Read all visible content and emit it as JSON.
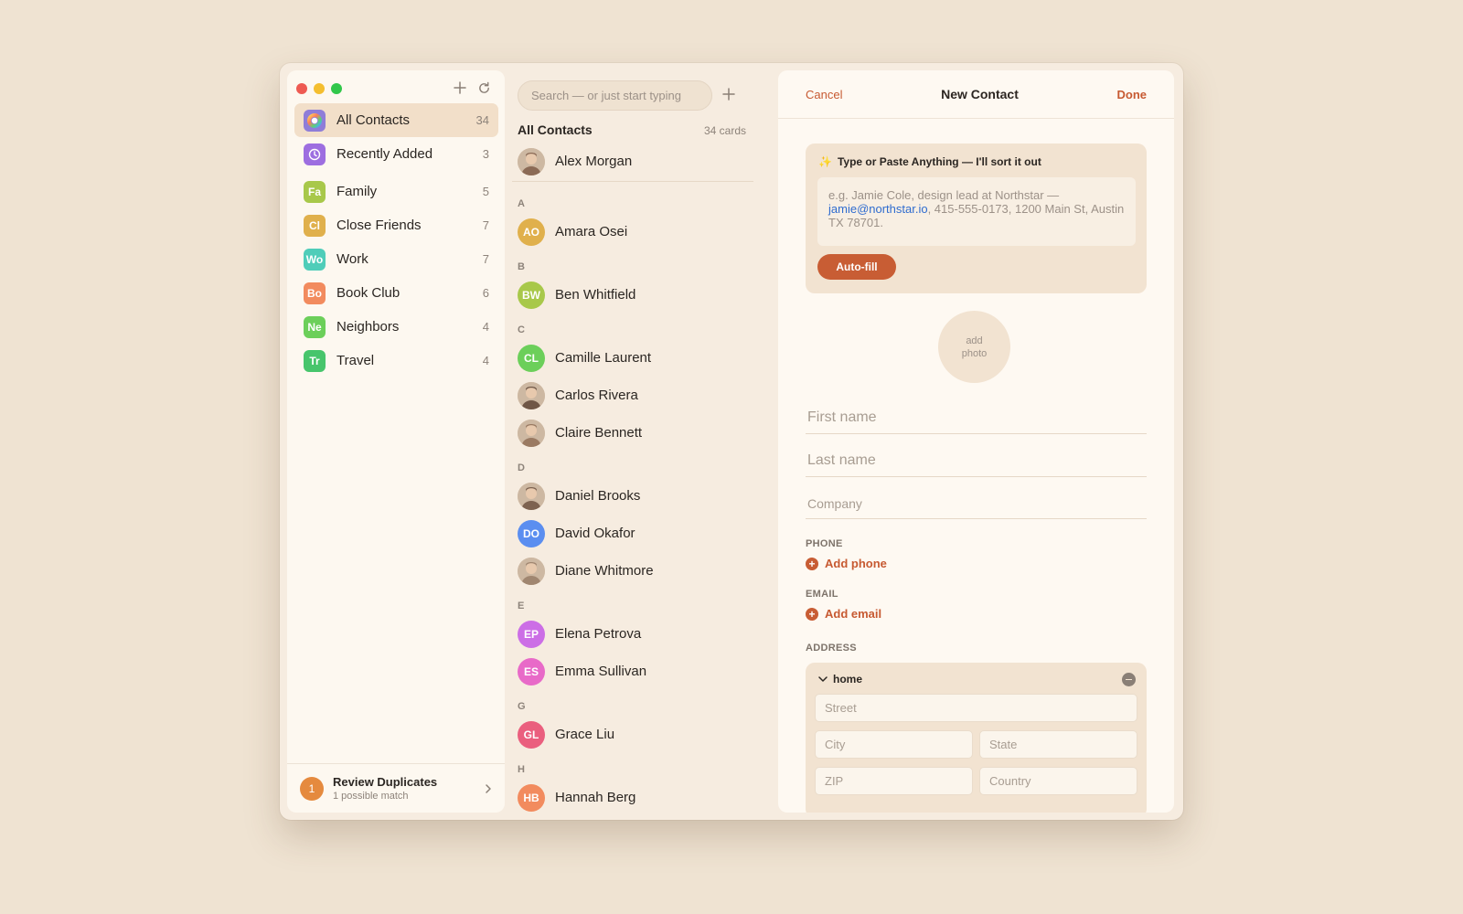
{
  "sidebar": {
    "items": [
      {
        "label": "All Contacts",
        "count": "34",
        "icon": "rainbow-ring-icon",
        "active": true
      },
      {
        "label": "Recently Added",
        "count": "3",
        "icon": "clock-icon",
        "color": "#9d6ee0"
      },
      {
        "label": "Family",
        "count": "5",
        "abbr": "Fa",
        "color": "#a8c84a"
      },
      {
        "label": "Close Friends",
        "count": "7",
        "abbr": "Cl",
        "color": "#e0b04c"
      },
      {
        "label": "Work",
        "count": "7",
        "abbr": "Wo",
        "color": "#4fcdb9"
      },
      {
        "label": "Book Club",
        "count": "6",
        "abbr": "Bo",
        "color": "#f28b5e"
      },
      {
        "label": "Neighbors",
        "count": "4",
        "abbr": "Ne",
        "color": "#6ccf5a"
      },
      {
        "label": "Travel",
        "count": "4",
        "abbr": "Tr",
        "color": "#47c56c"
      }
    ],
    "duplicates": {
      "count": "1",
      "title": "Review Duplicates",
      "subtitle": "1 possible match"
    }
  },
  "list": {
    "search_placeholder": "Search — or just start typing",
    "heading": "All Contacts",
    "card_count": "34 cards",
    "me": {
      "name": "Alex Morgan",
      "photo": true
    },
    "sections": [
      {
        "letter": "A",
        "contacts": [
          {
            "name": "Amara Osei",
            "initials": "AO",
            "color": "#e0b04c"
          }
        ]
      },
      {
        "letter": "B",
        "contacts": [
          {
            "name": "Ben Whitfield",
            "initials": "BW",
            "color": "#a8c84a"
          }
        ]
      },
      {
        "letter": "C",
        "contacts": [
          {
            "name": "Camille Laurent",
            "initials": "CL",
            "color": "#6ccf5a"
          },
          {
            "name": "Carlos Rivera",
            "photo": true
          },
          {
            "name": "Claire Bennett",
            "photo": true
          }
        ]
      },
      {
        "letter": "D",
        "contacts": [
          {
            "name": "Daniel Brooks",
            "photo": true
          },
          {
            "name": "David Okafor",
            "initials": "DO",
            "color": "#5b8ef0"
          },
          {
            "name": "Diane Whitmore",
            "photo": true
          }
        ]
      },
      {
        "letter": "E",
        "contacts": [
          {
            "name": "Elena Petrova",
            "initials": "EP",
            "color": "#cc6ee6"
          },
          {
            "name": "Emma Sullivan",
            "initials": "ES",
            "color": "#e86ac8"
          }
        ]
      },
      {
        "letter": "G",
        "contacts": [
          {
            "name": "Grace Liu",
            "initials": "GL",
            "color": "#ea5f7e"
          }
        ]
      },
      {
        "letter": "H",
        "contacts": [
          {
            "name": "Hannah Berg",
            "initials": "HB",
            "color": "#f28b5e"
          }
        ]
      }
    ]
  },
  "editor": {
    "cancel": "Cancel",
    "title": "New Contact",
    "done": "Done",
    "paste_heading": "Type or Paste Anything — I'll sort it out",
    "paste_example_pre": "e.g. Jamie Cole, design lead at Northstar —",
    "paste_example_link": "jamie@northstar.io",
    "paste_example_post": ", 415-555-0173, 1200 Main St, Austin TX 78701.",
    "autofill": "Auto-fill",
    "add_photo": "add photo",
    "first_name": "First name",
    "last_name": "Last name",
    "company": "Company",
    "phone_label": "PHONE",
    "add_phone": "Add phone",
    "email_label": "EMAIL",
    "add_email": "Add email",
    "address_label": "ADDRESS",
    "address_kind": "home",
    "street": "Street",
    "city": "City",
    "state": "State",
    "zip": "ZIP",
    "country": "Country"
  },
  "colors": {
    "accent": "#c85d34",
    "sidebar_active": "#f2dfc9",
    "background": "#efe3d2"
  }
}
